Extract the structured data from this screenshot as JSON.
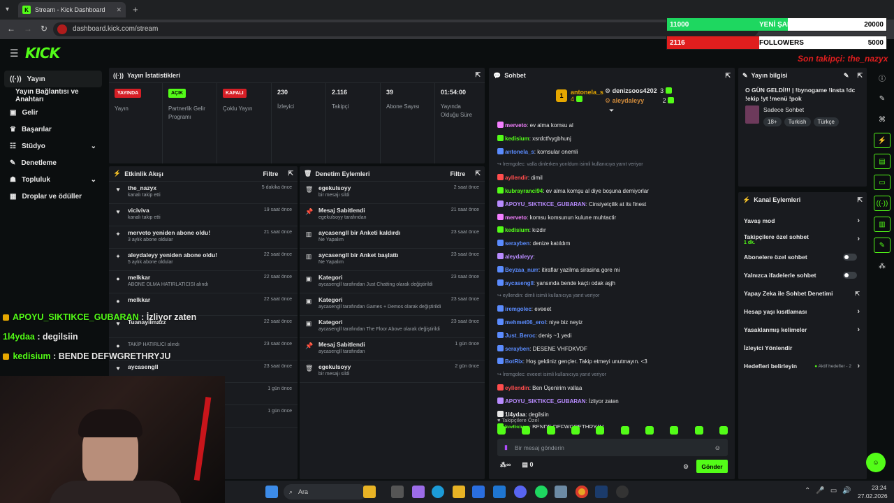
{
  "browser": {
    "tab_title": "Stream - Kick Dashboard",
    "url": "dashboard.kick.com/stream"
  },
  "brand": {
    "logo": "KICK",
    "accent": "#53fc18"
  },
  "sidebar": {
    "items": [
      {
        "label": "Yayın",
        "icon": "broadcast-icon"
      },
      {
        "label": "Yayın Bağlantısı ve Anahtarı",
        "icon": ""
      },
      {
        "label": "Gelir",
        "icon": "money-icon"
      },
      {
        "label": "Başarılar",
        "icon": "trophy-icon"
      },
      {
        "label": "Stüdyo",
        "icon": "sliders-icon"
      },
      {
        "label": "Denetleme",
        "icon": "wrench-icon"
      },
      {
        "label": "Topluluk",
        "icon": "people-icon"
      },
      {
        "label": "Droplar ve ödüller",
        "icon": "grid-icon"
      }
    ]
  },
  "stats": {
    "title": "Yayın İstatistikleri",
    "items": [
      {
        "badge": "YAYINDA",
        "label": "Yayın"
      },
      {
        "badge": "AÇIK",
        "label": "Partnerlik Gelir Programı"
      },
      {
        "badge": "KAPALI",
        "label": "Çoklu Yayın"
      },
      {
        "value": "230",
        "label": "İzleyici"
      },
      {
        "value": "2.116",
        "label": "Takipçi"
      },
      {
        "value": "39",
        "label": "Abone Sayısı"
      },
      {
        "value": "01:54:00",
        "label": "Yayında Olduğu Süre"
      }
    ]
  },
  "activity": {
    "title": "Etkinlik Akışı",
    "filter": "Filtre",
    "rows": [
      {
        "t": "the_nazyx",
        "s": "kanalı takip etti",
        "tm": "5 dakika önce",
        "icon": "heart-icon"
      },
      {
        "t": "viciviva",
        "s": "kanalı takip etti",
        "tm": "19 saat önce",
        "icon": "heart-icon"
      },
      {
        "t": "merveto yeniden abone oldu!",
        "s": "3 aylık abone oldular",
        "tm": "21 saat önce",
        "icon": "star-icon"
      },
      {
        "t": "aleydaleyy yeniden abone oldu!",
        "s": "5 aylık abone oldular",
        "tm": "22 saat önce",
        "icon": "star-icon"
      },
      {
        "t": "melkkar",
        "s": "ABONE OLMA HATIRLATICISI alındı",
        "tm": "22 saat önce",
        "icon": "gift-icon"
      },
      {
        "t": "melkkar",
        "s": "",
        "tm": "22 saat önce",
        "icon": "gift-icon"
      },
      {
        "t": "Tuanayilmazz",
        "s": "",
        "tm": "22 saat önce",
        "icon": "heart-icon"
      },
      {
        "t": "",
        "s": "TAKİP HATIRLICI alındı",
        "tm": "23 saat önce",
        "icon": "gift-icon"
      },
      {
        "t": "aycasengll",
        "s": "",
        "tm": "23 saat önce",
        "icon": "heart-icon"
      },
      {
        "t": "",
        "s": "",
        "tm": "1 gün önce",
        "icon": ""
      },
      {
        "t": "",
        "s": "",
        "tm": "1 gün önce",
        "icon": ""
      }
    ]
  },
  "moderation": {
    "title": "Denetim Eylemleri",
    "filter": "Filtre",
    "rows": [
      {
        "t": "egekulsoyy",
        "s": "bir mesajı sildi",
        "tm": "2 saat önce",
        "icon": "trash-icon"
      },
      {
        "t": "Mesaj Sabitlendi",
        "s": "egekulsoyy tarafından",
        "tm": "21 saat önce",
        "icon": "pin-icon"
      },
      {
        "t": "aycasengll bir Anketi kaldırdı",
        "s": "Ne Yapalım",
        "tm": "23 saat önce",
        "icon": "poll-icon"
      },
      {
        "t": "aycasengll bir Anket başlattı",
        "s": "Ne Yapalım",
        "tm": "23 saat önce",
        "icon": "poll-icon"
      },
      {
        "t": "Kategori",
        "s": "aycasengll tarafından Just Chatting olarak değiştirildi",
        "tm": "23 saat önce",
        "icon": "category-icon"
      },
      {
        "t": "Kategori",
        "s": "aycasengll tarafından Games + Demos olarak değiştirildi",
        "tm": "23 saat önce",
        "icon": "category-icon"
      },
      {
        "t": "Kategori",
        "s": "aycasengll tarafından The Floor Above olarak değiştirildi",
        "tm": "23 saat önce",
        "icon": "category-icon"
      },
      {
        "t": "Mesaj Sabitlendi",
        "s": "aycasengll tarafından",
        "tm": "1 gün önce",
        "icon": "pin-icon"
      },
      {
        "t": "egekulsoyy",
        "s": "bir mesajı sildi",
        "tm": "2 gün önce",
        "icon": "trash-icon"
      }
    ]
  },
  "chat": {
    "title": "Sohbet",
    "top": [
      {
        "name": "antonela_s",
        "count": "4"
      },
      {
        "name": "denizsoos4202",
        "count": "3"
      },
      {
        "name": "aleydaleyy",
        "count": "2"
      }
    ],
    "lines": [
      {
        "u": "merveto",
        "c": "#f47fff",
        "m": "ev alma komsu al"
      },
      {
        "u": "kedisium",
        "c": "#53fc18",
        "m": "xsrdctfvygbhunj"
      },
      {
        "u": "antonela_s",
        "c": "#5b8cff",
        "m": "komsular onemli"
      },
      {
        "reply": "İremgolec: valla dinlerken yorıldum isimli kullanıcıya yanıt veriyor"
      },
      {
        "u": "ayllendir",
        "c": "#ff4d4d",
        "m": "dimil"
      },
      {
        "u": "kubrayranci94",
        "c": "#53fc18",
        "m": "ev alma komşu al diye boşuna demiyorlar"
      },
      {
        "u": "APOYU_SIKTIKCE_GUBARAN",
        "c": "#b98cff",
        "m": "Cinsiyetçilik at its finest"
      },
      {
        "u": "merveto",
        "c": "#f47fff",
        "m": "komsu komsunun kulune muhtactir"
      },
      {
        "u": "kedisium",
        "c": "#53fc18",
        "m": "kızdır"
      },
      {
        "u": "serayben",
        "c": "#5b8cff",
        "m": "denize katıldım"
      },
      {
        "u": "aleydaleyy",
        "c": "#b98cff",
        "m": ""
      },
      {
        "u": "Beyzaa_nurr",
        "c": "#5b8cff",
        "m": "itiraflar yazilma sirasina gore mi"
      },
      {
        "u": "aycasengll",
        "c": "#5b8cff",
        "m": "yansında bende kaçtı odak aşjh"
      },
      {
        "reply": "eyllendin: dimli isimli kullanıcıya yanıt veriyor"
      },
      {
        "u": "iremgolec",
        "c": "#5b8cff",
        "m": "eveeet"
      },
      {
        "u": "mehmet06_erol",
        "c": "#5b8cff",
        "m": "niye biz neyiz"
      },
      {
        "u": "Just_Beroc",
        "c": "#5b8cff",
        "m": "deniş ~1 yedi"
      },
      {
        "u": "serayben",
        "c": "#5b8cff",
        "m": "DESENE VHFDKVDF"
      },
      {
        "u": "BotRix",
        "c": "#5b8cff",
        "m": "Hoş geldiniz gençler. Takip etmeyi unutmayın. <3"
      },
      {
        "reply": "İremgolec: eveeet isimli kullanıcıya yanıt veriyor"
      },
      {
        "u": "eyllendin",
        "c": "#ff4d4d",
        "m": "Ben Üşenirim vallaa"
      },
      {
        "u": "APOYU_SIKTIKCE_GUBARAN",
        "c": "#b98cff",
        "m": "İzliyor zaten"
      },
      {
        "u": "1l4ydaa",
        "c": "#e8e8e8",
        "m": "degilsiin"
      },
      {
        "u": "kedisium",
        "c": "#53fc18",
        "m": "BENDE DEFWGRETHRYJU"
      }
    ],
    "followers_only": "Takipçilere Özel",
    "placeholder": "Bir mesaj gönderin",
    "send": "Gönder",
    "viewers_count": "0"
  },
  "stream_info": {
    "title": "Yayın bilgisi",
    "headline": "O GÜN GELDİ!!! | !bynogame !insta !dc !ekip !yt !menü !pok",
    "category": "Sadece Sohbet",
    "tags": [
      "18+",
      "Turkish",
      "Türkçe"
    ]
  },
  "channel_actions": {
    "title": "Kanal Eylemleri",
    "items": [
      {
        "label": "Yavaş mod",
        "type": "chevron"
      },
      {
        "label": "Takipçilere özel sohbet",
        "sub": "1 dk.",
        "type": "chevron"
      },
      {
        "label": "Abonelere özel sohbet",
        "type": "toggle"
      },
      {
        "label": "Yalnızca ifadelerle sohbet",
        "type": "toggle"
      },
      {
        "label": "Yapay Zeka ile Sohbet Denetimi",
        "type": "external"
      },
      {
        "label": "Hesap yaşı kısıtlaması",
        "type": "chevron"
      },
      {
        "label": "Yasaklanmış kelimeler",
        "type": "chevron"
      },
      {
        "label": "İzleyici Yönlendir",
        "type": "none"
      },
      {
        "label": "Hedefleri belirleyin",
        "sub": "Aktif hedefler - 2",
        "type": "chevron"
      }
    ]
  },
  "overlay": {
    "goal1_current": "11000",
    "goal1_label": "YENİ ŞARKI",
    "goal1_target": "20000",
    "goal1_progress": 0.55,
    "goal2_current": "2116",
    "goal2_label": "FOLLOWERS",
    "goal2_target": "5000",
    "goal2_progress": 0.42,
    "last_follower": "Son takipçi: the_nazyx",
    "chat": [
      {
        "u": "APOYU_SIKTIKCE_GUBARAN",
        "m": "İzliyor zaten"
      },
      {
        "u": "1l4ydaa",
        "m": "degilsiin"
      },
      {
        "u": "kedisium",
        "m": "BENDE DEFWGRETHRYJU"
      }
    ]
  },
  "taskbar": {
    "search": "Ara",
    "time": "23:24",
    "date": "27.02.2026"
  }
}
